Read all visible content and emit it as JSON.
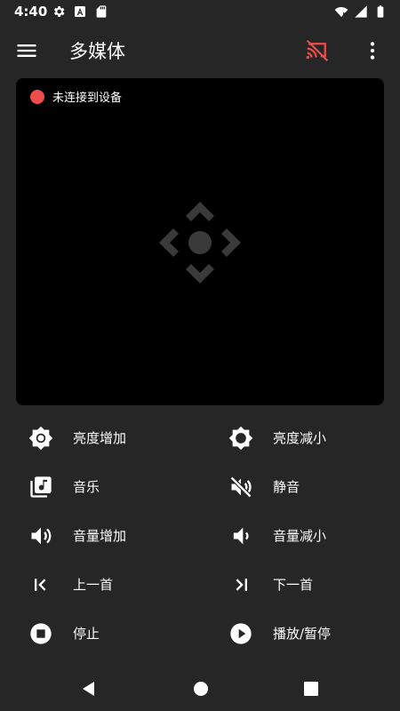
{
  "status_bar": {
    "time": "4:40",
    "left_icons": [
      "gear-icon",
      "font-icon",
      "sd-card-icon"
    ],
    "right_icons": [
      "wifi-icon",
      "signal-icon",
      "battery-icon"
    ]
  },
  "app_bar": {
    "title": "多媒体",
    "cast_icon_color": "#ef4c4c"
  },
  "remote_panel": {
    "connection_status": "未连接到设备",
    "status_color": "#ef4c4c"
  },
  "controls": [
    {
      "left": {
        "label": "亮度增加",
        "icon": "brightness-high-icon"
      },
      "right": {
        "label": "亮度减小",
        "icon": "brightness-low-icon"
      }
    },
    {
      "left": {
        "label": "音乐",
        "icon": "music-library-icon"
      },
      "right": {
        "label": "静音",
        "icon": "volume-off-icon"
      }
    },
    {
      "left": {
        "label": "音量增加",
        "icon": "volume-up-icon"
      },
      "right": {
        "label": "音量减小",
        "icon": "volume-down-icon"
      }
    },
    {
      "left": {
        "label": "上一首",
        "icon": "skip-previous-icon"
      },
      "right": {
        "label": "下一首",
        "icon": "skip-next-icon"
      }
    },
    {
      "left": {
        "label": "停止",
        "icon": "stop-icon"
      },
      "right": {
        "label": "播放/暂停",
        "icon": "play-pause-icon"
      }
    }
  ],
  "colors": {
    "background": "#262626",
    "panel": "#000000",
    "accent_red": "#ef4c4c"
  }
}
